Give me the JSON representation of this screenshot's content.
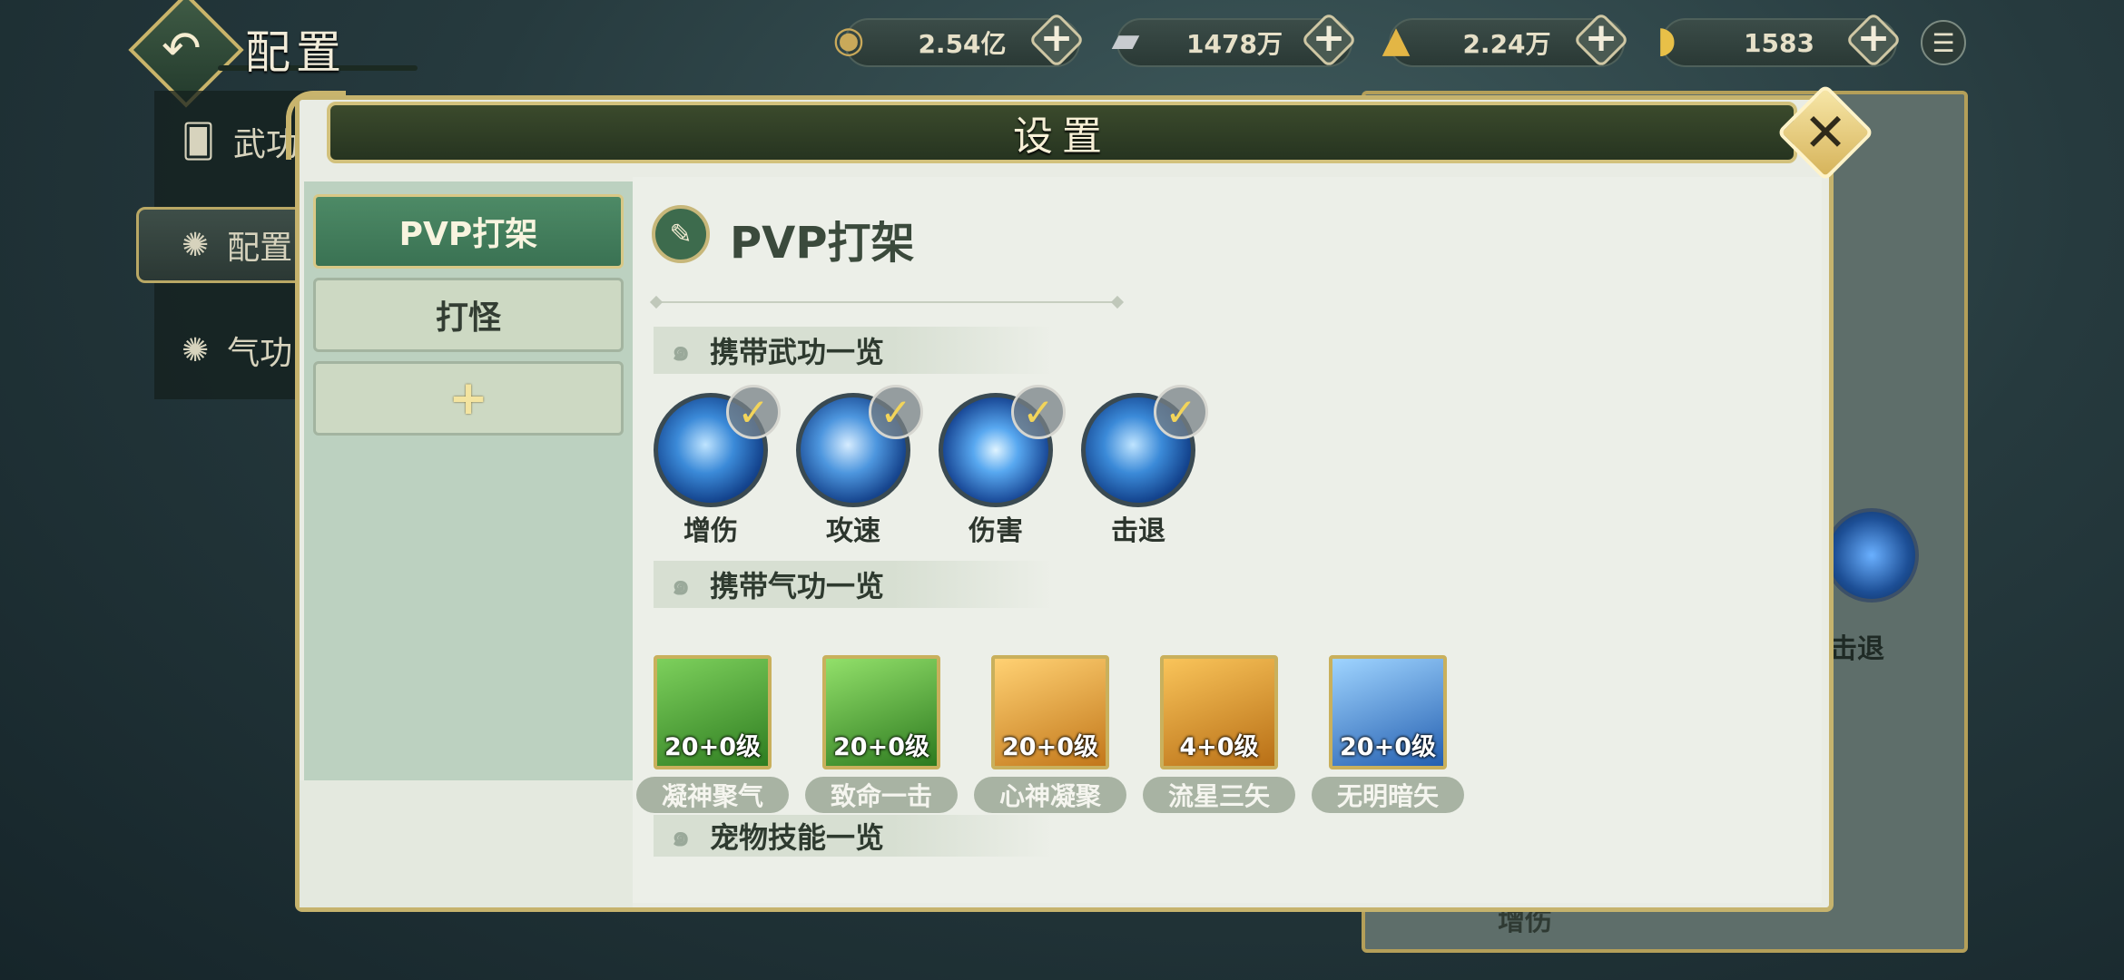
{
  "header": {
    "title": "配置",
    "currencies": [
      {
        "icon": "coin-icon",
        "value": "2.54亿"
      },
      {
        "icon": "silver-bar-icon",
        "value": "1478万"
      },
      {
        "icon": "gold-ingot-icon",
        "value": "2.24万"
      },
      {
        "icon": "yuanbao-icon",
        "value": "1583"
      }
    ]
  },
  "bg_sidebar": {
    "items": [
      {
        "label": "武功"
      },
      {
        "label": "配置"
      },
      {
        "label": "气功"
      }
    ]
  },
  "bg_panel": {
    "skill_label": "击退",
    "bottom_label": "增伤"
  },
  "modal": {
    "title": "设置",
    "tabs": [
      {
        "label": "PVP打架",
        "active": true
      },
      {
        "label": "打怪",
        "active": false
      },
      {
        "label": "+",
        "active": false
      }
    ],
    "preset_title": "PVP打架",
    "sections": {
      "martial": "携带武功一览",
      "qigong": "携带气功一览",
      "pet": "宠物技能一览"
    },
    "martial_skills": [
      {
        "name": "增伤",
        "checked": true
      },
      {
        "name": "攻速",
        "checked": true
      },
      {
        "name": "伤害",
        "checked": true
      },
      {
        "name": "击退",
        "checked": true
      }
    ],
    "qigong_skills": [
      {
        "name": "凝神聚气",
        "level": "20+0级",
        "color": "#3f8f2a"
      },
      {
        "name": "致命一击",
        "level": "20+0级",
        "color": "#3c8a26"
      },
      {
        "name": "心神凝聚",
        "level": "20+0级",
        "color": "#d2891c"
      },
      {
        "name": "流星三矢",
        "level": "4+0级",
        "color": "#cc8a20"
      },
      {
        "name": "无明暗矢",
        "level": "20+0级",
        "color": "#2f78c8"
      }
    ]
  }
}
